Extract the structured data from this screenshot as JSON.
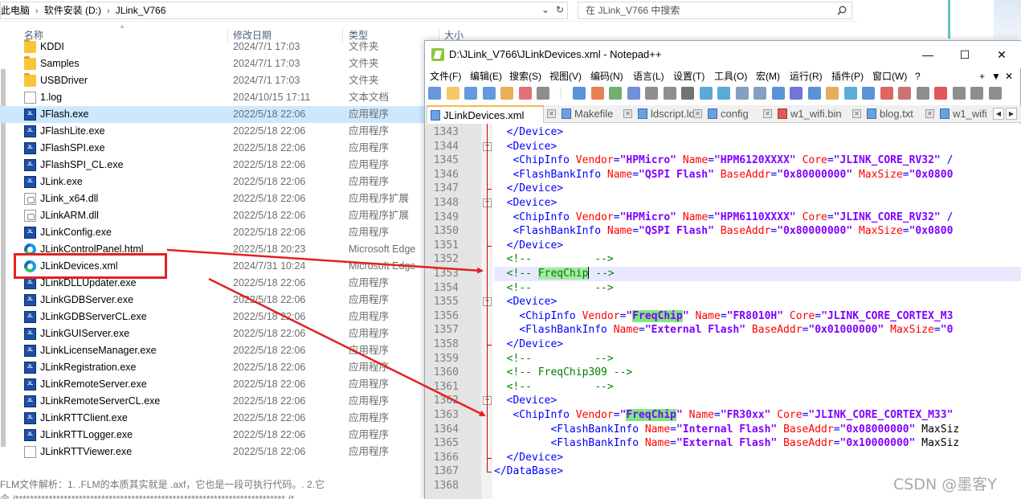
{
  "explorer": {
    "breadcrumb": [
      "此电脑",
      "软件安装 (D:)",
      "JLink_V766"
    ],
    "search_placeholder": "在 JLink_V766 中搜索",
    "columns": {
      "name": "名称",
      "date": "修改日期",
      "type": "类型",
      "size": "大小"
    },
    "files": [
      {
        "name": "KDDI",
        "date": "2024/7/1 17:03",
        "type": "文件夹",
        "icon": "folder-icon"
      },
      {
        "name": "Samples",
        "date": "2024/7/1 17:03",
        "type": "文件夹",
        "icon": "folder-icon"
      },
      {
        "name": "USBDriver",
        "date": "2024/7/1 17:03",
        "type": "文件夹",
        "icon": "folder-icon"
      },
      {
        "name": "1.log",
        "date": "2024/10/15 17:11",
        "type": "文本文档",
        "icon": "text-file-icon"
      },
      {
        "name": "JFlash.exe",
        "date": "2022/5/18 22:06",
        "type": "应用程序",
        "icon": "jflash-exe-icon"
      },
      {
        "name": "JFlashLite.exe",
        "date": "2022/5/18 22:06",
        "type": "应用程序",
        "icon": "exe-icon"
      },
      {
        "name": "JFlashSPI.exe",
        "date": "2022/5/18 22:06",
        "type": "应用程序",
        "icon": "exe-icon"
      },
      {
        "name": "JFlashSPI_CL.exe",
        "date": "2022/5/18 22:06",
        "type": "应用程序",
        "icon": "exe-icon"
      },
      {
        "name": "JLink.exe",
        "date": "2022/5/18 22:06",
        "type": "应用程序",
        "icon": "exe-icon"
      },
      {
        "name": "JLink_x64.dll",
        "date": "2022/5/18 22:06",
        "type": "应用程序扩展",
        "icon": "dll-icon"
      },
      {
        "name": "JLinkARM.dll",
        "date": "2022/5/18 22:06",
        "type": "应用程序扩展",
        "icon": "dll-icon"
      },
      {
        "name": "JLinkConfig.exe",
        "date": "2022/5/18 22:06",
        "type": "应用程序",
        "icon": "exe-icon"
      },
      {
        "name": "JLinkControlPanel.html",
        "date": "2022/5/18 20:23",
        "type": "Microsoft Edge",
        "icon": "edge-icon"
      },
      {
        "name": "JLinkDevices.xml",
        "date": "2024/7/31 10:24",
        "type": "Microsoft Edge",
        "icon": "edge-icon"
      },
      {
        "name": "JLinkDLLUpdater.exe",
        "date": "2022/5/18 22:06",
        "type": "应用程序",
        "icon": "exe-icon"
      },
      {
        "name": "JLinkGDBServer.exe",
        "date": "2022/5/18 22:06",
        "type": "应用程序",
        "icon": "exe-icon"
      },
      {
        "name": "JLinkGDBServerCL.exe",
        "date": "2022/5/18 22:06",
        "type": "应用程序",
        "icon": "exe-icon"
      },
      {
        "name": "JLinkGUIServer.exe",
        "date": "2022/5/18 22:06",
        "type": "应用程序",
        "icon": "exe-icon"
      },
      {
        "name": "JLinkLicenseManager.exe",
        "date": "2022/5/18 22:06",
        "type": "应用程序",
        "icon": "exe-icon"
      },
      {
        "name": "JLinkRegistration.exe",
        "date": "2022/5/18 22:06",
        "type": "应用程序",
        "icon": "exe-icon"
      },
      {
        "name": "JLinkRemoteServer.exe",
        "date": "2022/5/18 22:06",
        "type": "应用程序",
        "icon": "exe-icon"
      },
      {
        "name": "JLinkRemoteServerCL.exe",
        "date": "2022/5/18 22:06",
        "type": "应用程序",
        "icon": "exe-icon"
      },
      {
        "name": "JLinkRTTClient.exe",
        "date": "2022/5/18 22:06",
        "type": "应用程序",
        "icon": "exe-icon"
      },
      {
        "name": "JLinkRTTLogger.exe",
        "date": "2022/5/18 22:06",
        "type": "应用程序",
        "icon": "exe-icon"
      },
      {
        "name": "JLinkRTTViewer.exe",
        "date": "2022/5/18 22:06",
        "type": "应用程序",
        "icon": "text-file-icon"
      }
    ],
    "selected_file": "JFlash.exe",
    "highlighted_file": "JLinkDevices.xml",
    "bottom_text_line1": "FLM文件解析：1. .FLM的本质其实就是 .axf，它也是一段可执行代码。. 2.它",
    "bottom_text_line2": "令    /************************************************************************ /*"
  },
  "notepad": {
    "title": "D:\\JLink_V766\\JLinkDevices.xml - Notepad++",
    "window_buttons": {
      "minimize": "—",
      "maximize": "☐",
      "close": "✕"
    },
    "menu": [
      "文件(F)",
      "编辑(E)",
      "搜索(S)",
      "视图(V)",
      "编码(N)",
      "语言(L)",
      "设置(T)",
      "工具(O)",
      "宏(M)",
      "运行(R)",
      "插件(P)",
      "窗口(W)",
      "?"
    ],
    "menu_extra": [
      "+",
      "▼",
      "✕"
    ],
    "tabs": [
      {
        "label": "JLinkDevices.xml",
        "active": true
      },
      {
        "label": "Makefile",
        "active": false
      },
      {
        "label": "ldscript.ld",
        "active": false
      },
      {
        "label": "config",
        "active": false
      },
      {
        "label": "w1_wifi.bin",
        "active": false
      },
      {
        "label": "blog.txt",
        "active": false
      },
      {
        "label": "w1_wifi.",
        "active": false
      }
    ],
    "tab_nav": [
      "◀",
      "▶"
    ],
    "line_numbers": [
      "1343",
      "1344",
      "1345",
      "1346",
      "1347",
      "1348",
      "1349",
      "1350",
      "1351",
      "1352",
      "1353",
      "1354",
      "1355",
      "1356",
      "1357",
      "1358",
      "1359",
      "1360",
      "1361",
      "1362",
      "1363",
      "1364",
      "1365",
      "1366",
      "1367",
      "1368"
    ],
    "current_line": "1353",
    "highlight_term": "FreqChip",
    "code_lines": [
      "  </Device>",
      "  <Device>",
      "   <ChipInfo Vendor=\"HPMicro\" Name=\"HPM6120XXXX\" Core=\"JLINK_CORE_RV32\" /",
      "   <FlashBankInfo Name=\"QSPI Flash\" BaseAddr=\"0x80000000\" MaxSize=\"0x0800",
      "  </Device>",
      "  <Device>",
      "   <ChipInfo Vendor=\"HPMicro\" Name=\"HPM6110XXXX\" Core=\"JLINK_CORE_RV32\" /",
      "   <FlashBankInfo Name=\"QSPI Flash\" BaseAddr=\"0x80000000\" MaxSize=\"0x0800",
      "  </Device>",
      "  <!--          -->",
      "  <!-- FreqChip -->",
      "  <!--          -->",
      "  <Device>",
      "    <ChipInfo Vendor=\"FreqChip\" Name=\"FR8010H\" Core=\"JLINK_CORE_CORTEX_M3",
      "    <FlashBankInfo Name=\"External Flash\" BaseAddr=\"0x01000000\" MaxSize=\"0",
      "  </Device>",
      "  <!--          -->",
      "  <!-- FreqChip309 -->",
      "  <!--          -->",
      "  <Device>",
      "   <ChipInfo Vendor=\"FreqChip\" Name=\"FR30xx\" Core=\"JLINK_CORE_CORTEX_M33\"",
      "         <FlashBankInfo Name=\"Internal Flash\" BaseAddr=\"0x08000000\" MaxSiz",
      "         <FlashBankInfo Name=\"External Flash\" BaseAddr=\"0x10000000\" MaxSiz",
      "  </Device>",
      "</DataBase>",
      ""
    ]
  },
  "watermark": "CSDN @墨客Y",
  "colors": {
    "arrow": "#e32121",
    "selection": "#cce8ff",
    "highlight": "#7ee87e",
    "tab_accent": "#f7b84b"
  }
}
